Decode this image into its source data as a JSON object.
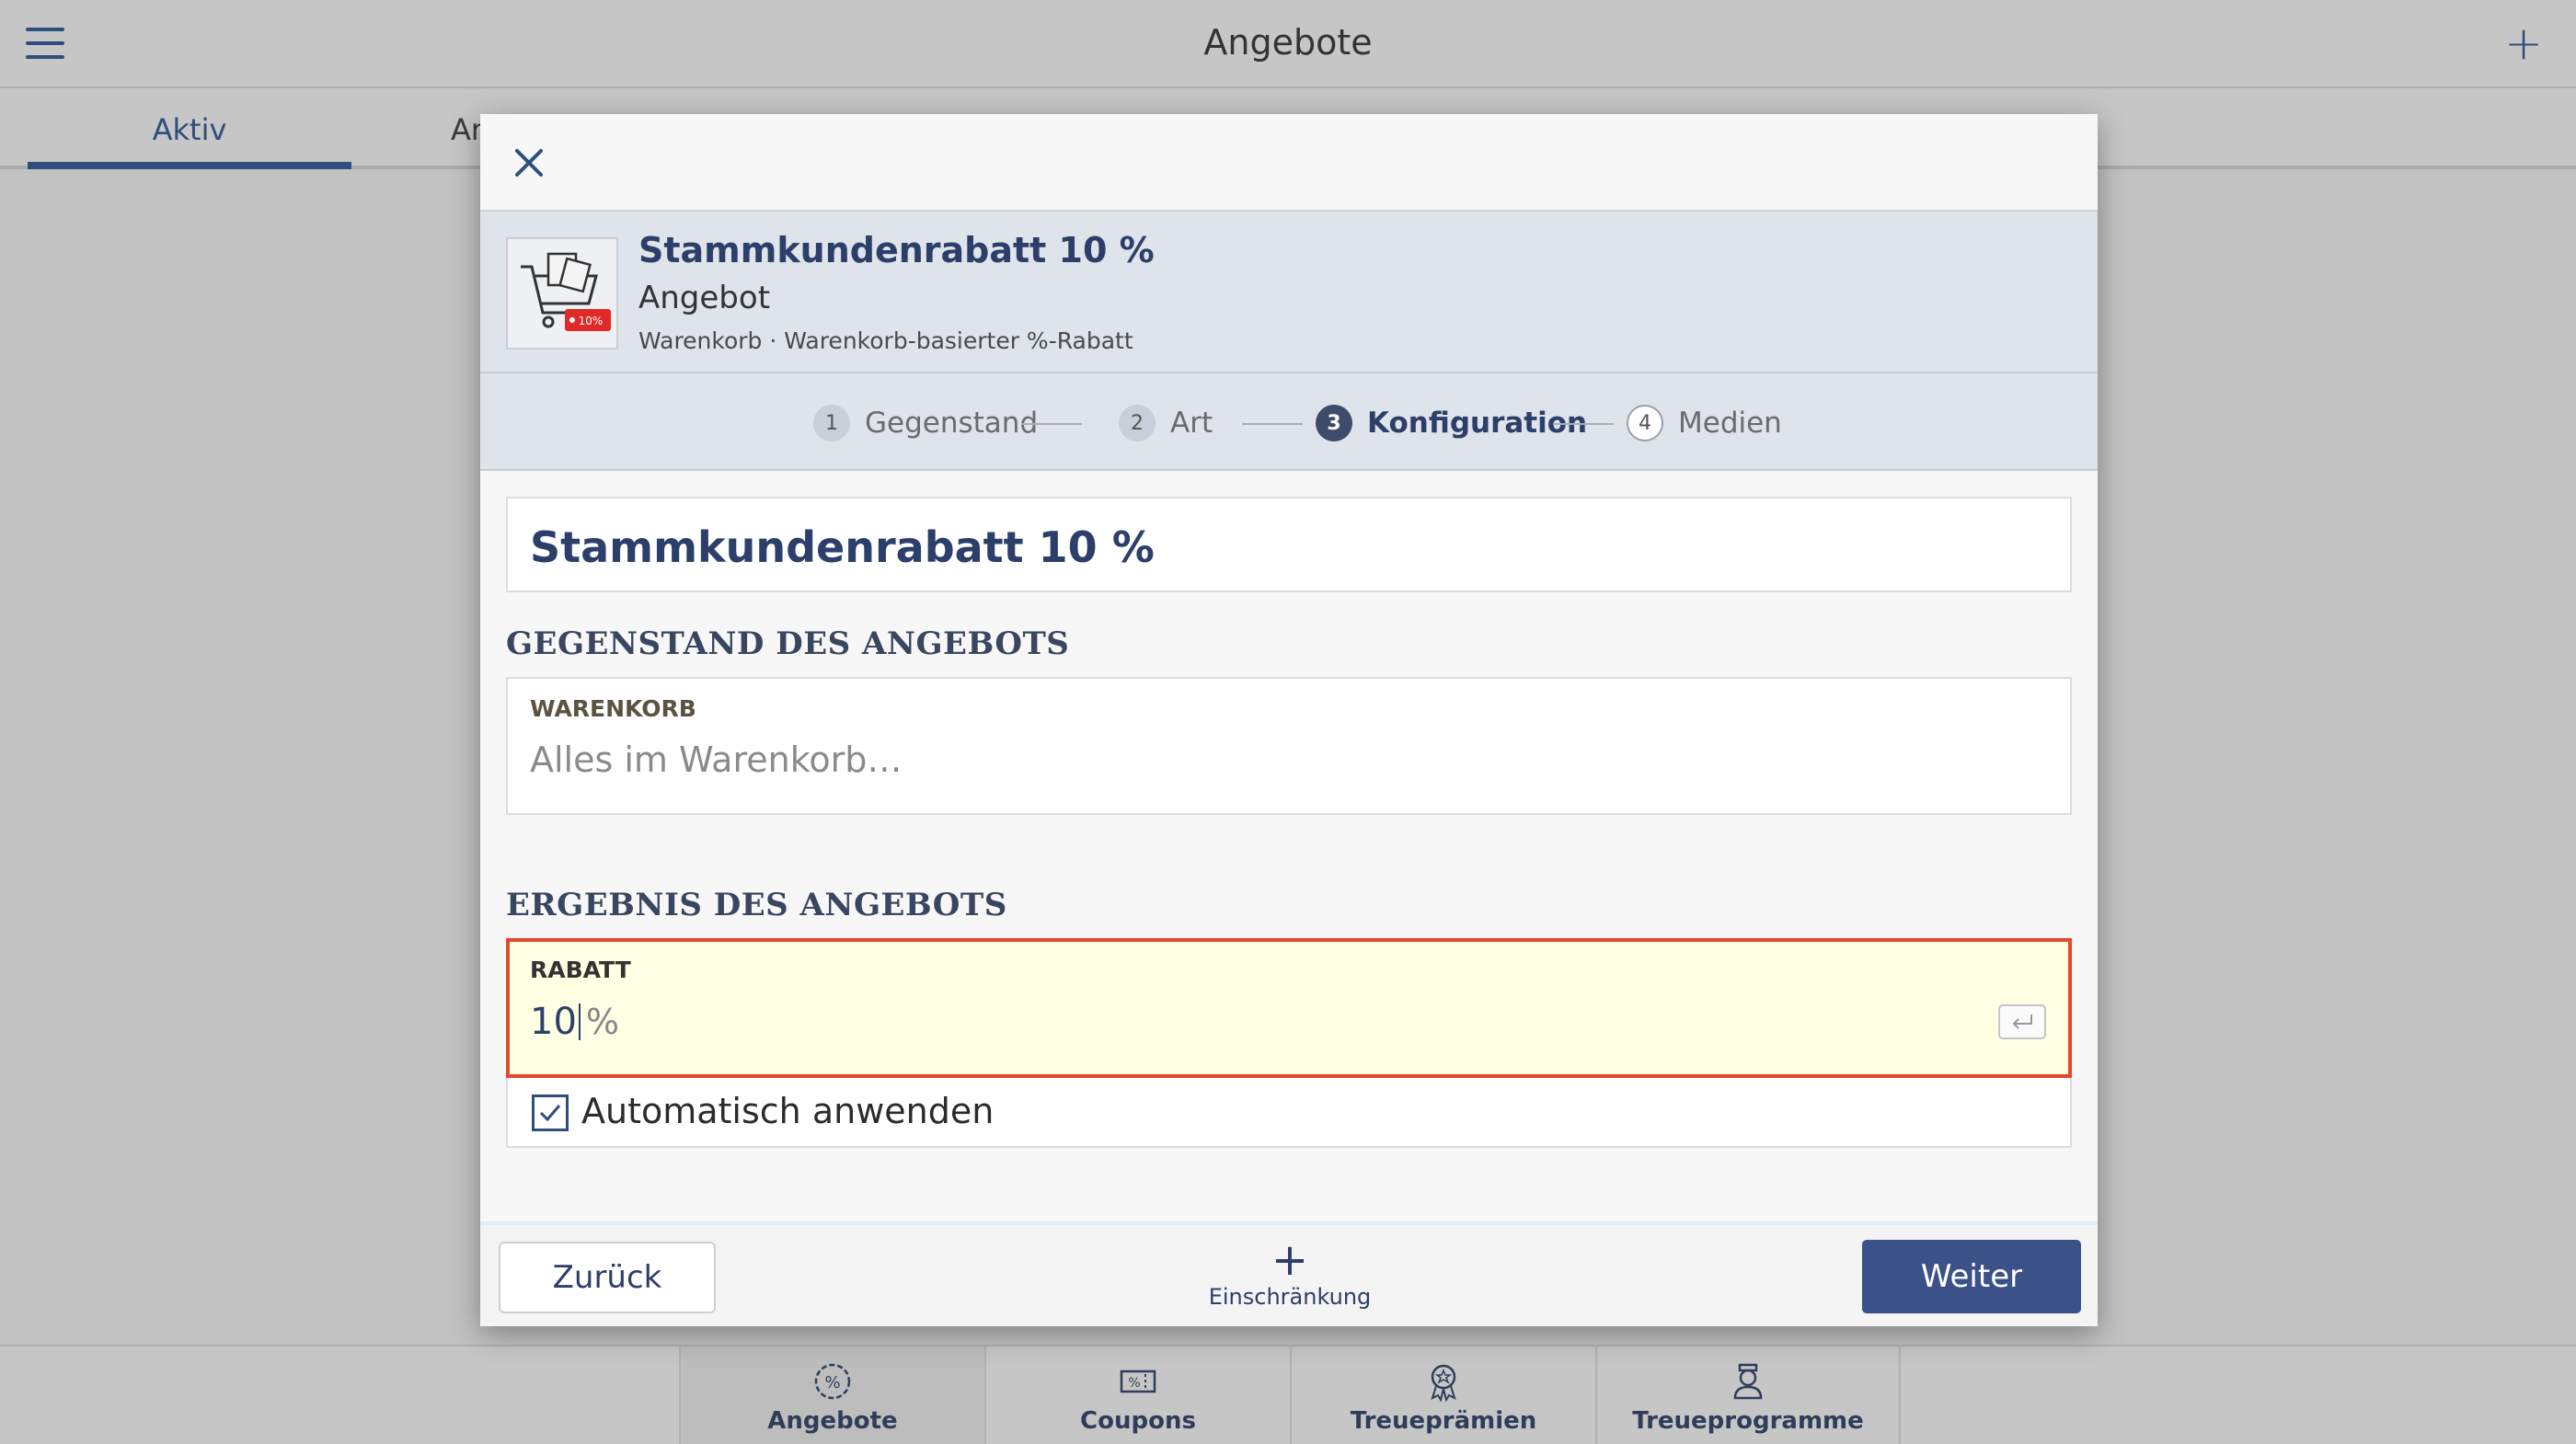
{
  "app": {
    "title": "Angebote",
    "add_icon": "plus-icon"
  },
  "tabs": [
    {
      "label": "Aktiv",
      "active": true
    },
    {
      "label": "Ar"
    }
  ],
  "modal": {
    "offer": {
      "title": "Stammkundenrabatt 10 %",
      "type": "Angebot",
      "subtitle": "Warenkorb · Warenkorb-basierter %-Rabatt",
      "badge": "10%"
    },
    "steps": [
      {
        "num": "1",
        "label": "Gegenstand",
        "state": "done"
      },
      {
        "num": "2",
        "label": "Art",
        "state": "done"
      },
      {
        "num": "3",
        "label": "Konfiguration",
        "state": "current"
      },
      {
        "num": "4",
        "label": "Medien",
        "state": "future"
      }
    ],
    "name_value": "Stammkundenrabatt 10 %",
    "section_subject": "GEGENSTAND DES ANGEBOTS",
    "basket_field": {
      "label": "WARENKORB",
      "placeholder": "Alles im Warenkorb…"
    },
    "section_result": "ERGEBNIS DES ANGEBOTS",
    "discount_field": {
      "label": "RABATT",
      "value": "10",
      "unit": "%"
    },
    "auto_apply": {
      "label": "Automatisch anwenden",
      "checked": true
    },
    "footer": {
      "back_label": "Zurück",
      "add_label": "Einschränkung",
      "next_label": "Weiter"
    }
  },
  "bottom_nav": [
    {
      "label": "Angebote",
      "icon": "percent-badge-icon",
      "active": true
    },
    {
      "label": "Coupons",
      "icon": "coupon-icon"
    },
    {
      "label": "Treueprämien",
      "icon": "award-icon"
    },
    {
      "label": "Treueprogramme",
      "icon": "person-badge-icon"
    }
  ],
  "colors": {
    "accent": "#3b5289",
    "error_border": "#e5492c",
    "focus_bg": "#ffffe4"
  }
}
